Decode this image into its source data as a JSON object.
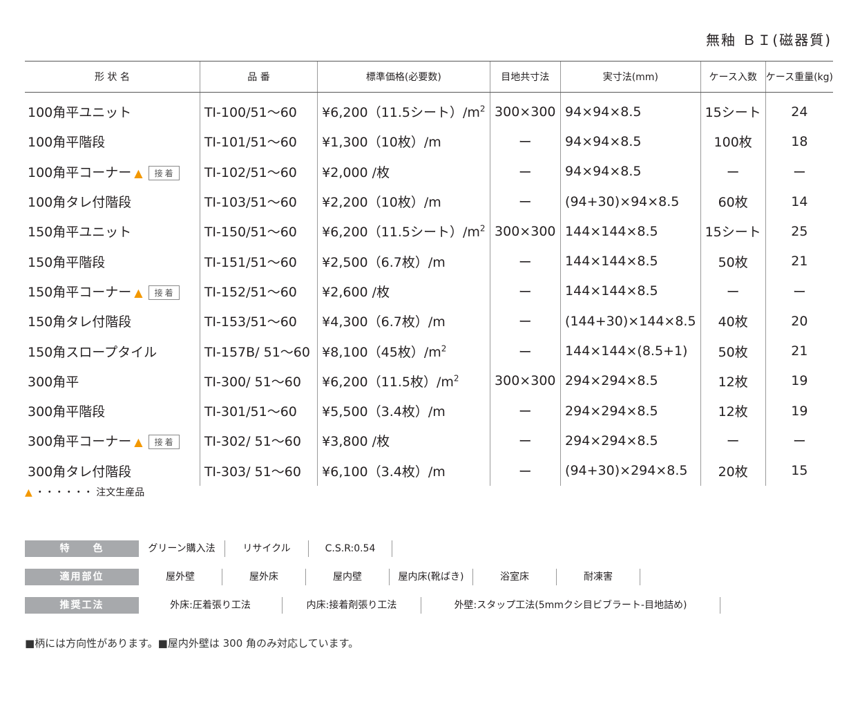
{
  "title": "無釉 ＢＩ(磁器質)",
  "headers": [
    "形 状 名",
    "品 番",
    "標準価格(必要数)",
    "目地共寸法",
    "実寸法(mm)",
    "ケース入数",
    "ケース重量(kg)"
  ],
  "badge": "接着",
  "rows": [
    {
      "name": "100角平ユニット",
      "code": "TI-100/51〜60",
      "price": "¥6,200（11.5シート）/m",
      "sup": "2",
      "joint": "300×300",
      "size": "94×94×8.5",
      "qty": "15シート",
      "weight": "24",
      "tri": false
    },
    {
      "name": "100角平階段",
      "code": "TI-101/51〜60",
      "price": "¥1,300（10枚）/m",
      "sup": "",
      "joint": "ー",
      "size": "94×94×8.5",
      "qty": "100枚",
      "weight": "18",
      "tri": false
    },
    {
      "name": "100角平コーナー",
      "code": "TI-102/51〜60",
      "price": "¥2,000 /枚",
      "sup": "",
      "joint": "ー",
      "size": "94×94×8.5",
      "qty": "ー",
      "weight": "ー",
      "tri": true
    },
    {
      "name": "100角タレ付階段",
      "code": "TI-103/51〜60",
      "price": "¥2,200（10枚）/m",
      "sup": "",
      "joint": "ー",
      "size": "(94+30)×94×8.5",
      "qty": "60枚",
      "weight": "14",
      "tri": false
    },
    {
      "name": "150角平ユニット",
      "code": "TI-150/51〜60",
      "price": "¥6,200（11.5シート）/m",
      "sup": "2",
      "joint": "300×300",
      "size": "144×144×8.5",
      "qty": "15シート",
      "weight": "25",
      "tri": false
    },
    {
      "name": "150角平階段",
      "code": "TI-151/51〜60",
      "price": "¥2,500（6.7枚）/m",
      "sup": "",
      "joint": "ー",
      "size": "144×144×8.5",
      "qty": "50枚",
      "weight": "21",
      "tri": false
    },
    {
      "name": "150角平コーナー",
      "code": "TI-152/51〜60",
      "price": "¥2,600 /枚",
      "sup": "",
      "joint": "ー",
      "size": "144×144×8.5",
      "qty": "ー",
      "weight": "ー",
      "tri": true
    },
    {
      "name": "150角タレ付階段",
      "code": "TI-153/51〜60",
      "price": "¥4,300（6.7枚）/m",
      "sup": "",
      "joint": "ー",
      "size": "(144+30)×144×8.5",
      "qty": "40枚",
      "weight": "20",
      "tri": false
    },
    {
      "name": "150角スロープタイル",
      "code": "TI-157B/ 51〜60",
      "price": "¥8,100（45枚）/m",
      "sup": "2",
      "joint": "ー",
      "size": "144×144×(8.5+1)",
      "qty": "50枚",
      "weight": "21",
      "tri": false
    },
    {
      "name": "300角平",
      "code": "TI-300/ 51〜60",
      "price": "¥6,200（11.5枚）/m",
      "sup": "2",
      "joint": "300×300",
      "size": "294×294×8.5",
      "qty": "12枚",
      "weight": "19",
      "tri": false
    },
    {
      "name": "300角平階段",
      "code": "TI-301/51〜60",
      "price": "¥5,500（3.4枚）/m",
      "sup": "",
      "joint": "ー",
      "size": "294×294×8.5",
      "qty": "12枚",
      "weight": "19",
      "tri": false
    },
    {
      "name": "300角平コーナー",
      "code": "TI-302/ 51〜60",
      "price": "¥3,800 /枚",
      "sup": "",
      "joint": "ー",
      "size": "294×294×8.5",
      "qty": "ー",
      "weight": "ー",
      "tri": true
    },
    {
      "name": "300角タレ付階段",
      "code": "TI-303/ 51〜60",
      "price": "¥6,100（3.4枚）/m",
      "sup": "",
      "joint": "ー",
      "size": "(94+30)×294×8.5",
      "qty": "20枚",
      "weight": "15",
      "tri": false
    }
  ],
  "note": "・・・・・・ 注文生産品",
  "features": {
    "label": "特　　色",
    "items": [
      "グリーン購入法",
      "リサイクル",
      "C.S.R:0.54"
    ]
  },
  "areas": {
    "label": "適用部位",
    "items": [
      "屋外壁",
      "屋外床",
      "屋内壁",
      "屋内床(靴ばき)",
      "浴室床",
      "耐凍害"
    ]
  },
  "methods": {
    "label": "推奨工法",
    "items": [
      "外床:圧着張り工法",
      "内床:接着剤張り工法",
      "外壁:スタップ工法(5mmクシ目ビブラート-目地詰め)"
    ]
  },
  "footer": "■柄には方向性があります。■屋内外壁は 300 角のみ対応しています。",
  "colors": {
    "triangle": "#f39800",
    "label_bg": "#a7a9ac"
  }
}
